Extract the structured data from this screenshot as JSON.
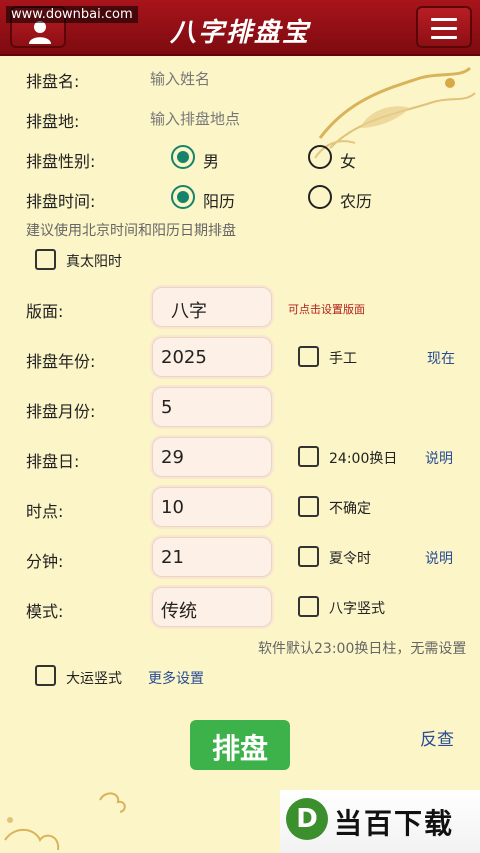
{
  "header": {
    "title": "八字排盘宝",
    "watermark": "www.downbai.com"
  },
  "form": {
    "name": {
      "label": "排盘名:",
      "placeholder": "输入姓名"
    },
    "place": {
      "label": "排盘地:",
      "placeholder": "输入排盘地点"
    },
    "gender": {
      "label": "排盘性别:",
      "options": [
        "男",
        "女"
      ],
      "selected": "男"
    },
    "calendar": {
      "label": "排盘时间:",
      "options": [
        "阳历",
        "农历"
      ],
      "selected": "阳历"
    },
    "calendar_hint": "建议使用北京时间和阳历日期排盘",
    "true_solar": "真太阳时",
    "layout": {
      "label": "版面:",
      "value": "八字",
      "hint": "可点击设置版面"
    },
    "year": {
      "label": "排盘年份:",
      "value": "2025",
      "check": "手工",
      "link": "现在"
    },
    "month": {
      "label": "排盘月份:",
      "value": "5"
    },
    "day": {
      "label": "排盘日:",
      "value": "29",
      "check": "24:00换日",
      "link": "说明"
    },
    "hour": {
      "label": "时点:",
      "value": "10",
      "check": "不确定"
    },
    "minute": {
      "label": "分钟:",
      "value": "21",
      "check": "夏令时",
      "link": "说明"
    },
    "mode": {
      "label": "模式:",
      "value": "传统",
      "check": "八字竖式"
    },
    "default_hint": "软件默认23:00换日柱，无需设置",
    "dayun": "大运竖式",
    "more": "更多设置"
  },
  "actions": {
    "paipan": "排盘",
    "reverse": "反查"
  },
  "brand": {
    "logo_letter": "D",
    "logo_text": "当百下载"
  },
  "colors": {
    "header": "#8e0f14",
    "background": "#fbf5c8",
    "radio_selected": "#16836b",
    "button": "#3db24b",
    "link": "#2a4d95"
  }
}
